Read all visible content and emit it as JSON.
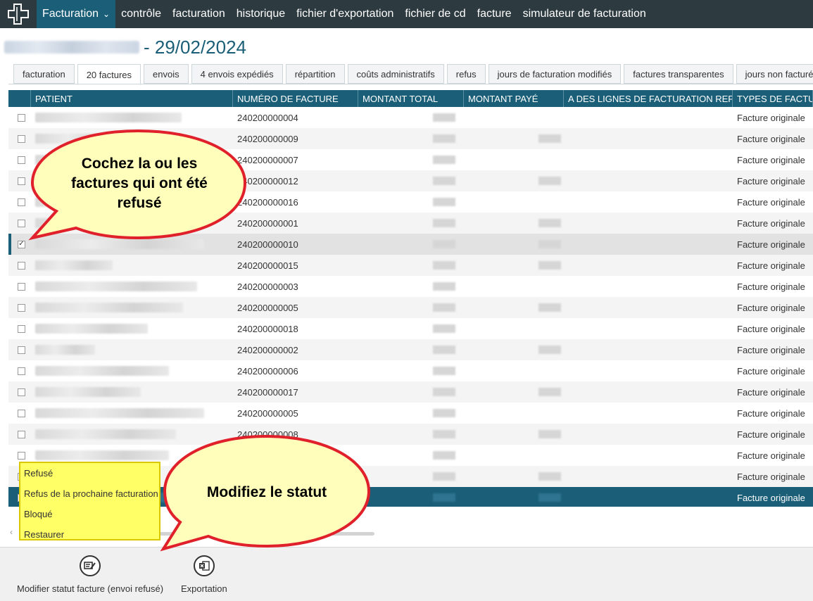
{
  "nav": {
    "app_label": "Facturation",
    "items": [
      "contrôle",
      "facturation",
      "historique",
      "fichier d'exportation",
      "fichier de cd",
      "facture",
      "simulateur de facturation"
    ]
  },
  "page": {
    "title": "- 29/02/2024"
  },
  "tabs": [
    "facturation",
    "20 factures",
    "envois",
    "4 envois expédiés",
    "répartition",
    "coûts administratifs",
    "refus",
    "jours de facturation modifiés",
    "factures transparentes",
    "jours non facturés"
  ],
  "active_tab": 1,
  "grid": {
    "columns": [
      "PATIENT",
      "NUMÉRO DE FACTURE",
      "MONTANT TOTAL",
      "MONTANT PAYÉ",
      "A DES LIGNES DE FACTURATION REFUSÉES",
      "TYPES DE FACTURATION"
    ],
    "rows": [
      {
        "invoice": "240200000004",
        "type": "Facture originale",
        "checked": false
      },
      {
        "invoice": "240200000009",
        "type": "Facture originale",
        "checked": false
      },
      {
        "invoice": "240200000007",
        "type": "Facture originale",
        "checked": false
      },
      {
        "invoice": "240200000012",
        "type": "Facture originale",
        "checked": false
      },
      {
        "invoice": "240200000016",
        "type": "Facture originale",
        "checked": false
      },
      {
        "invoice": "240200000001",
        "type": "Facture originale",
        "checked": false
      },
      {
        "invoice": "240200000010",
        "type": "Facture originale",
        "checked": true
      },
      {
        "invoice": "240200000015",
        "type": "Facture originale",
        "checked": false
      },
      {
        "invoice": "240200000003",
        "type": "Facture originale",
        "checked": false
      },
      {
        "invoice": "240200000005",
        "type": "Facture originale",
        "checked": false
      },
      {
        "invoice": "240200000018",
        "type": "Facture originale",
        "checked": false
      },
      {
        "invoice": "240200000002",
        "type": "Facture originale",
        "checked": false
      },
      {
        "invoice": "240200000006",
        "type": "Facture originale",
        "checked": false
      },
      {
        "invoice": "240200000017",
        "type": "Facture originale",
        "checked": false
      },
      {
        "invoice": "240200000005",
        "type": "Facture originale",
        "checked": false
      },
      {
        "invoice": "240200000008",
        "type": "Facture originale",
        "checked": false
      },
      {
        "invoice": "",
        "type": "Facture originale",
        "checked": false
      },
      {
        "invoice": "",
        "type": "Facture originale",
        "checked": false
      },
      {
        "invoice": "",
        "type": "Facture originale",
        "checked": false,
        "selected": true
      }
    ]
  },
  "dropdown": {
    "items": [
      "Refusé",
      "Refus de la prochaine facturation",
      "Bloqué",
      "Restaurer"
    ]
  },
  "toolbar": {
    "modify_label": "Modifier statut facture (envoi refusé)",
    "export_label": "Exportation"
  },
  "callouts": {
    "check_text": "Cochez la ou les factures qui ont été refusé",
    "status_text": "Modifiez le statut"
  },
  "colors": {
    "nav_bg": "#2d3a40",
    "accent": "#1a5e78",
    "callout_fill": "#ffffbb",
    "callout_border": "#e0202a",
    "dropdown_fill": "#ffff66"
  }
}
